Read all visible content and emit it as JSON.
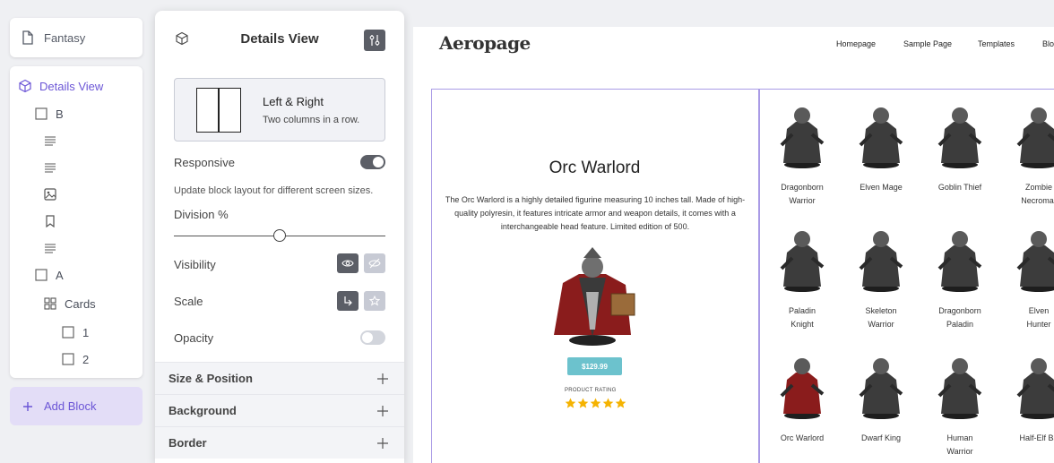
{
  "tree": {
    "page_name": "Fantasy",
    "root": "Details View",
    "block_b": "B",
    "block_a": "A",
    "cards": "Cards",
    "card_1": "1",
    "card_2": "2",
    "add_block": "Add Block",
    "icons": [
      "page-icon",
      "cube-icon",
      "checkbox-icon",
      "text-lines-icon",
      "image-icon",
      "bookmark-icon",
      "grid-icon",
      "plus-icon"
    ]
  },
  "details": {
    "title": "Details View",
    "layout_name": "Left & Right",
    "layout_desc": "Two columns in a row.",
    "responsive_label": "Responsive",
    "responsive_on": true,
    "responsive_help": "Update block layout for different screen sizes.",
    "division_label": "Division %",
    "division_fraction": 0.5,
    "visibility_label": "Visibility",
    "scale_label": "Scale",
    "opacity_label": "Opacity",
    "opacity_on": false,
    "sections": [
      "Size & Position",
      "Background",
      "Border"
    ]
  },
  "site": {
    "logo": "Aeropage",
    "nav": [
      "Homepage",
      "Sample Page",
      "Templates",
      "Blo"
    ],
    "product_title": "Orc Warlord",
    "product_desc": "The Orc Warlord is a highly detailed figurine measuring 10 inches tall. Made of high-quality polyresin, it features intricate armor and weapon details, it comes with a interchangeable head feature. Limited edition of 500.",
    "price": "$129.99",
    "rating_label": "PRODUCT RATING",
    "rating": 5,
    "cards": [
      [
        "Dragonborn",
        "Warrior"
      ],
      [
        "Elven Mage"
      ],
      [
        "Goblin Thief"
      ],
      [
        "Zombie",
        "Necromar"
      ],
      [
        "Paladin",
        "Knight"
      ],
      [
        "Skeleton",
        "Warrior"
      ],
      [
        "Dragonborn",
        "Paladin"
      ],
      [
        "Elven",
        "Hunter"
      ],
      [
        "Orc Warlord"
      ],
      [
        "Dwarf King"
      ],
      [
        "Human",
        "Warrior"
      ],
      [
        "Half-Elf Ba"
      ]
    ]
  },
  "colors": {
    "accent": "#6b55d6",
    "add_block_bg": "#e3ddf7",
    "column_border": "#a99be6",
    "price_bg": "#6cc2cd",
    "star": "#f5b301"
  }
}
